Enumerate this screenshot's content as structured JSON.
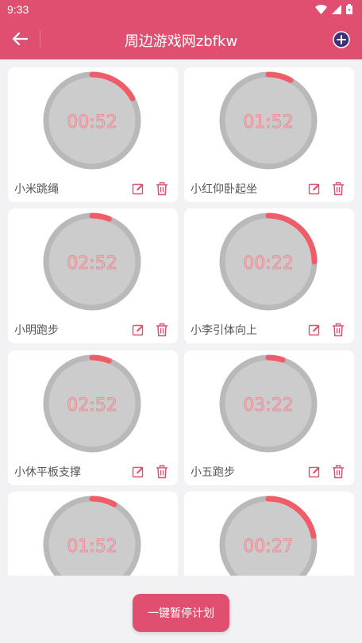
{
  "status_bar": {
    "time": "9:33"
  },
  "app_bar": {
    "title": "周边游戏网zbfkw"
  },
  "colors": {
    "primary": "#e04f6f",
    "ring": "#b9b9b9",
    "dial_fill": "#cccccc",
    "progress": "#f25b68",
    "time_text": "#f08a94"
  },
  "timers": [
    {
      "name": "小米跳绳",
      "time": "00:52",
      "progress": 0.17
    },
    {
      "name": "小红仰卧起坐",
      "time": "01:52",
      "progress": 0.08
    },
    {
      "name": "小明跑步",
      "time": "02:52",
      "progress": 0.06
    },
    {
      "name": "小李引体向上",
      "time": "00:22",
      "progress": 0.25
    },
    {
      "name": "小休平板支撑",
      "time": "02:52",
      "progress": 0.06
    },
    {
      "name": "小五跑步",
      "time": "03:22",
      "progress": 0.05
    },
    {
      "name": "",
      "time": "01:52",
      "progress": 0.08
    },
    {
      "name": "",
      "time": "00:27",
      "progress": 0.22
    }
  ],
  "bottom": {
    "pause_all_label": "一键暂停计划"
  }
}
